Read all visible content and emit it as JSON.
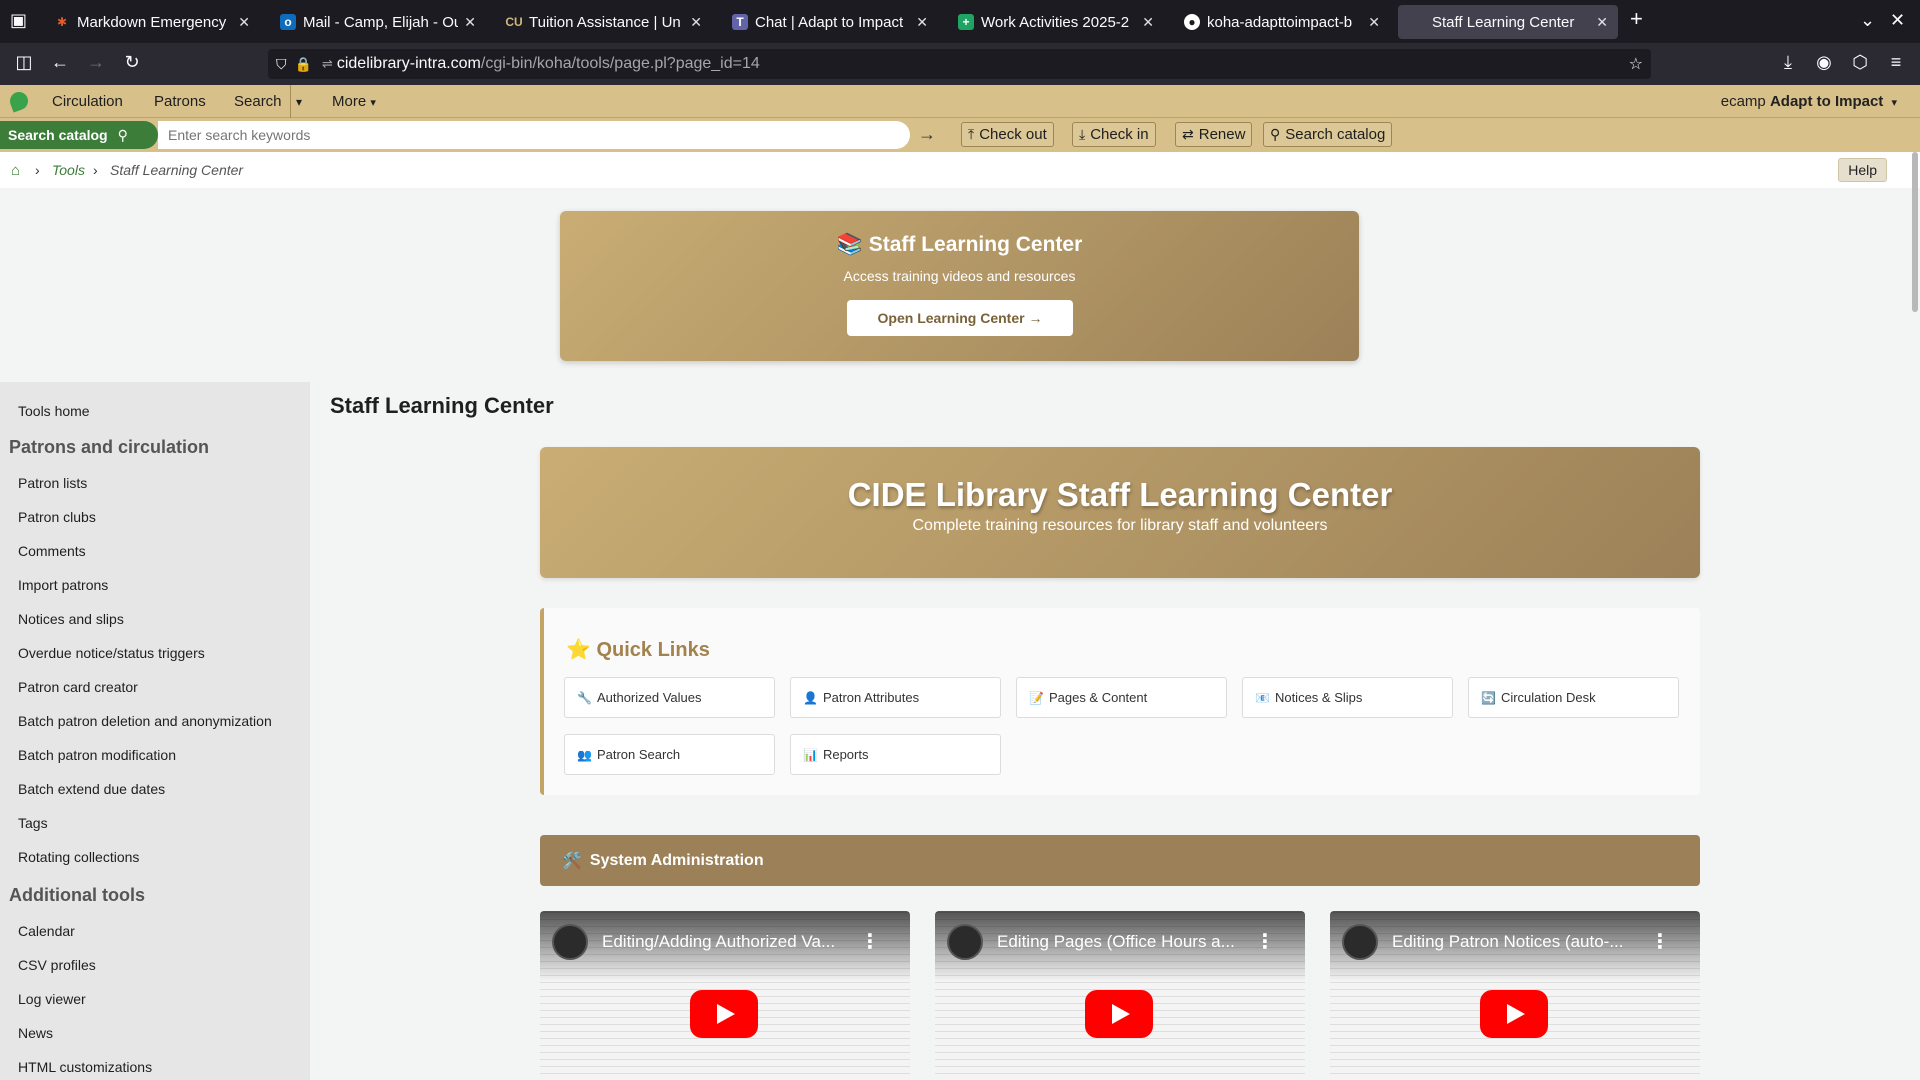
{
  "browser": {
    "tabs": [
      {
        "title": "Markdown Emergency",
        "icon": "sparkle-icon",
        "color": "#e05a2b"
      },
      {
        "title": "Mail - Camp, Elijah - Ou",
        "icon": "outlook-icon",
        "color": "#0f6cbd"
      },
      {
        "title": "Tuition Assistance | Un",
        "icon": "cu-icon",
        "color": "#cfb87c"
      },
      {
        "title": "Chat | Adapt to Impact",
        "icon": "teams-icon",
        "color": "#6264a7"
      },
      {
        "title": "Work Activities 2025-2",
        "icon": "sheets-icon",
        "color": "#1fa463"
      },
      {
        "title": "koha-adapttoimpact-b",
        "icon": "github-icon",
        "color": "#ffffff"
      },
      {
        "title": "Staff Learning Center",
        "icon": "",
        "color": ""
      }
    ],
    "url_host": "cidelibrary-intra.com",
    "url_path": "/cgi-bin/koha/tools/page.pl?page_id=14"
  },
  "header": {
    "nav": [
      "Circulation",
      "Patrons",
      "Search",
      "More"
    ],
    "user_prefix": "ecamp",
    "user_library": "Adapt to Impact"
  },
  "searchbar": {
    "label": "Search catalog",
    "placeholder": "Enter search keywords",
    "buttons": [
      "Check out",
      "Check in",
      "Renew",
      "Search catalog"
    ]
  },
  "breadcrumb": {
    "tools": "Tools",
    "current": "Staff Learning Center",
    "help": "Help"
  },
  "banner": {
    "title": "📚 Staff Learning Center",
    "subtitle": "Access training videos and resources",
    "button": "Open Learning Center →"
  },
  "sidebar": {
    "tools_home": "Tools home",
    "section1": "Patrons and circulation",
    "items1": [
      "Patron lists",
      "Patron clubs",
      "Comments",
      "Import patrons",
      "Notices and slips",
      "Overdue notice/status triggers",
      "Patron card creator",
      "Batch patron deletion and anonymization",
      "Batch patron modification",
      "Batch extend due dates",
      "Tags",
      "Rotating collections"
    ],
    "section2": "Additional tools",
    "items2": [
      "Calendar",
      "CSV profiles",
      "Log viewer",
      "News",
      "HTML customizations"
    ]
  },
  "main": {
    "page_title": "Staff Learning Center",
    "hero_title": "CIDE Library Staff Learning Center",
    "hero_subtitle": "Complete training resources for library staff and volunteers",
    "quick_title": "⭐ Quick Links",
    "quick_links": [
      {
        "icon": "🔧",
        "label": "Authorized Values"
      },
      {
        "icon": "👤",
        "label": "Patron Attributes"
      },
      {
        "icon": "📝",
        "label": "Pages & Content"
      },
      {
        "icon": "📧",
        "label": "Notices & Slips"
      },
      {
        "icon": "🔄",
        "label": "Circulation Desk"
      },
      {
        "icon": "👥",
        "label": "Patron Search"
      },
      {
        "icon": "📊",
        "label": "Reports"
      }
    ],
    "section_title": "System Administration",
    "section_icon": "🛠️",
    "videos": [
      "Editing/Adding Authorized Va...",
      "Editing Pages (Office Hours a...",
      "Editing Patron Notices (auto-..."
    ]
  }
}
